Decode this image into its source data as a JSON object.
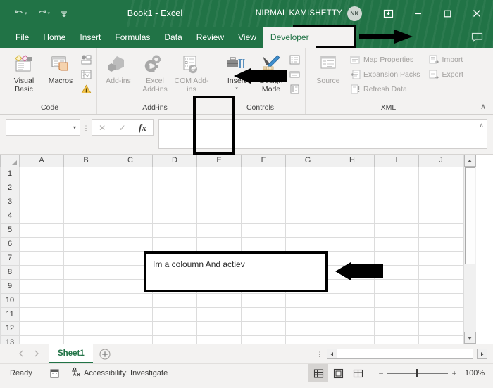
{
  "window": {
    "title": "Book1  -  Excel",
    "account_name": "NIRMAL KAMISHETTY",
    "account_initials": "NK",
    "brand_green": "#217346",
    "qat": [
      {
        "name": "undo",
        "glyph": "↶"
      },
      {
        "name": "redo",
        "glyph": "↷"
      },
      {
        "name": "customize-qat",
        "glyph": "⯆"
      }
    ],
    "buttons": {
      "ribbon_display": "ribbon-display-options",
      "minimize": "—",
      "maximize": "☐",
      "close": "✕"
    }
  },
  "tabs": [
    {
      "label": "File",
      "active": false
    },
    {
      "label": "Home",
      "active": false
    },
    {
      "label": "Insert",
      "active": false
    },
    {
      "label": "Formulas",
      "active": false
    },
    {
      "label": "Data",
      "active": false
    },
    {
      "label": "Review",
      "active": false
    },
    {
      "label": "View",
      "active": false
    },
    {
      "label": "Developer",
      "active": true
    }
  ],
  "ribbon": {
    "groups": [
      {
        "label": "Code",
        "big_buttons": [
          {
            "label": "Visual Basic",
            "icon": "visual-basic-icon",
            "disabled": false
          },
          {
            "label": "Macros",
            "icon": "macros-icon",
            "disabled": false
          }
        ],
        "small_buttons": [
          {
            "label": "",
            "icon": "record-macro-icon",
            "disabled": false
          },
          {
            "label": "",
            "icon": "relative-references-icon",
            "disabled": false
          },
          {
            "label": "",
            "icon": "macro-security-icon",
            "disabled": false
          }
        ]
      },
      {
        "label": "Add-ins",
        "big_buttons": [
          {
            "label": "Add-ins",
            "icon": "addins-icon",
            "disabled": true
          },
          {
            "label": "Excel Add-ins",
            "icon": "excel-addins-icon",
            "disabled": true
          },
          {
            "label": "COM Add-ins",
            "icon": "com-addins-icon",
            "disabled": true
          }
        ],
        "small_buttons": []
      },
      {
        "label": "Controls",
        "big_buttons": [
          {
            "label": "Insert",
            "icon": "insert-controls-icon",
            "disabled": false,
            "has_caret": true
          },
          {
            "label": "Design Mode",
            "icon": "design-mode-icon",
            "disabled": false
          }
        ],
        "small_buttons": [
          {
            "label": "",
            "icon": "properties-icon",
            "disabled": false
          },
          {
            "label": "",
            "icon": "view-code-icon",
            "disabled": false
          },
          {
            "label": "",
            "icon": "run-dialog-icon",
            "disabled": false
          }
        ]
      },
      {
        "label": "XML",
        "big_buttons": [
          {
            "label": "Source",
            "icon": "xml-source-icon",
            "disabled": true
          }
        ],
        "small_buttons": [
          {
            "label": "Map Properties",
            "icon": "map-properties-icon",
            "disabled": true
          },
          {
            "label": "Expansion Packs",
            "icon": "expansion-packs-icon",
            "disabled": true
          },
          {
            "label": "Refresh Data",
            "icon": "refresh-data-icon",
            "disabled": true
          },
          {
            "label": "Import",
            "icon": "import-icon",
            "disabled": true
          },
          {
            "label": "Export",
            "icon": "export-icon",
            "disabled": true
          }
        ]
      }
    ],
    "collapse_glyph": "∧"
  },
  "formula_bar": {
    "name_box_value": "",
    "name_box_caret": "▾",
    "cancel_glyph": "✕",
    "enter_glyph": "✓",
    "fx_label": "fx",
    "formula_value": "",
    "expand_glyph": "∧"
  },
  "grid": {
    "columns": [
      "A",
      "B",
      "C",
      "D",
      "E",
      "F",
      "G",
      "H",
      "I",
      "J"
    ],
    "rows": [
      "1",
      "2",
      "3",
      "4",
      "5",
      "6",
      "7",
      "8",
      "9",
      "10",
      "11",
      "12",
      "13"
    ]
  },
  "shape": {
    "text": "Im a coloumn And actiev"
  },
  "annotations": [
    {
      "name": "developer-tab-callout",
      "kind": "box-and-arrow",
      "target": "Developer"
    },
    {
      "name": "insert-control-callout",
      "kind": "box-and-arrow",
      "target": "Insert"
    },
    {
      "name": "textbox-callout",
      "kind": "arrow",
      "target": "text box"
    }
  ],
  "sheet_bar": {
    "prev_glyph": "◀",
    "next_glyph": "▶",
    "sheets": [
      {
        "label": "Sheet1",
        "active": true
      }
    ],
    "add_sheet_glyph": "+",
    "hscroll_left": "◀",
    "hscroll_right": "▶"
  },
  "status_bar": {
    "status": "Ready",
    "recording_icon": "record-macro-status-icon",
    "accessibility": "Accessibility: Investigate",
    "views": [
      {
        "name": "normal-view",
        "label": "normal",
        "selected": true
      },
      {
        "name": "page-layout-view",
        "label": "page-layout",
        "selected": false
      },
      {
        "name": "page-break-preview",
        "label": "page-break",
        "selected": false
      }
    ],
    "zoom_out": "−",
    "zoom_in": "+",
    "zoom_level": "100%"
  }
}
